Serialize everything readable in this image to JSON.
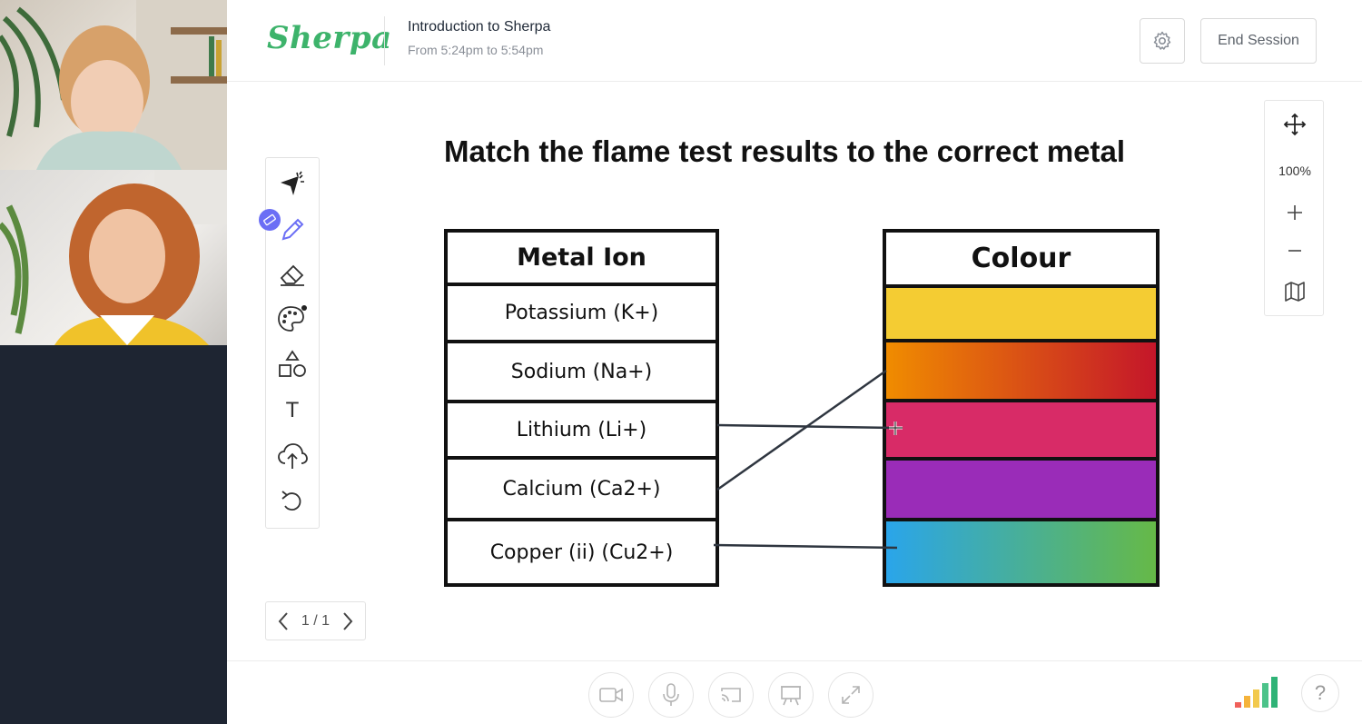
{
  "header": {
    "logo_text": "Sherpa",
    "session_title": "Introduction to Sherpa",
    "session_time": "From 5:24pm to 5:54pm",
    "settings_icon": "gear-icon",
    "end_session_label": "End Session"
  },
  "videos": [
    {
      "participant": "student",
      "icon": "video-feed"
    },
    {
      "participant": "tutor",
      "icon": "video-feed"
    }
  ],
  "toolbar": {
    "tools": [
      "laser-pointer-icon",
      "pen-icon",
      "eraser-icon",
      "palette-icon",
      "shapes-icon",
      "text-icon",
      "upload-cloud-icon",
      "undo-icon"
    ],
    "text_tool_glyph": "T",
    "active_tool": "pen-icon",
    "badge_icon": "ruler-icon"
  },
  "pager": {
    "label": "1 / 1"
  },
  "zoom": {
    "level": "100%",
    "icons": [
      "move-icon",
      "plus-icon",
      "minus-icon",
      "map-icon"
    ]
  },
  "worksheet": {
    "title": "Match the flame test results to the correct metal",
    "metal_header": "Metal Ion",
    "metals": [
      "Potassium (K+)",
      "Sodium (Na+)",
      "Lithium (Li+)",
      "Calcium (Ca2+)",
      "Copper (ii) (Cu2+)"
    ],
    "colour_header": "Colour",
    "colours": [
      {
        "name": "yellow",
        "from": "#f4cc33",
        "to": "#f4cc33"
      },
      {
        "name": "orange-red",
        "from": "#f08c00",
        "to": "#c4162a"
      },
      {
        "name": "crimson",
        "from": "#d82b67",
        "to": "#d82b67"
      },
      {
        "name": "purple",
        "from": "#9a2cb8",
        "to": "#9a2cb8"
      },
      {
        "name": "blue-green",
        "from": "#2aa5ea",
        "to": "#66b947"
      }
    ],
    "connections": [
      {
        "metal": "Lithium (Li+)",
        "colour": "crimson"
      },
      {
        "metal": "Calcium (Ca2+)",
        "colour": "orange-red"
      },
      {
        "metal": "Copper (ii) (Cu2+)",
        "colour": "blue-green"
      }
    ]
  },
  "bottom_bar": {
    "controls": [
      "camera-icon",
      "microphone-icon",
      "cast-icon",
      "whiteboard-icon",
      "fullscreen-icon"
    ],
    "signal_colors": [
      "#f0605a",
      "#f5b33b",
      "#f2c94c",
      "#4cc38a",
      "#2fb377"
    ],
    "help_label": "?"
  }
}
